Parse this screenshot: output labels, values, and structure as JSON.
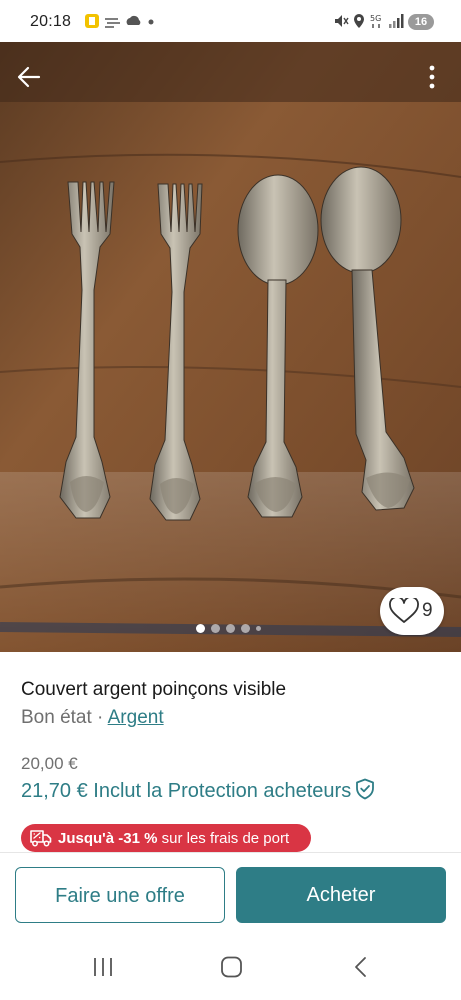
{
  "status": {
    "time": "20:18",
    "battery": "16"
  },
  "gallery": {
    "favorite_count": "9"
  },
  "item": {
    "title": "Couvert argent poinçons visible",
    "condition": "Bon état",
    "separator": " · ",
    "brand": "Argent",
    "price": "20,00 €",
    "price_with_protection": "21,70 €",
    "protection_label": "Inclut la Protection acheteurs",
    "promo_prefix": "Jusqu'à ",
    "promo_percent": "-31 %",
    "promo_suffix": " sur les frais de port"
  },
  "actions": {
    "offer_label": "Faire une offre",
    "buy_label": "Acheter"
  },
  "colors": {
    "accent": "#2e7d86",
    "promo": "#d93544"
  }
}
